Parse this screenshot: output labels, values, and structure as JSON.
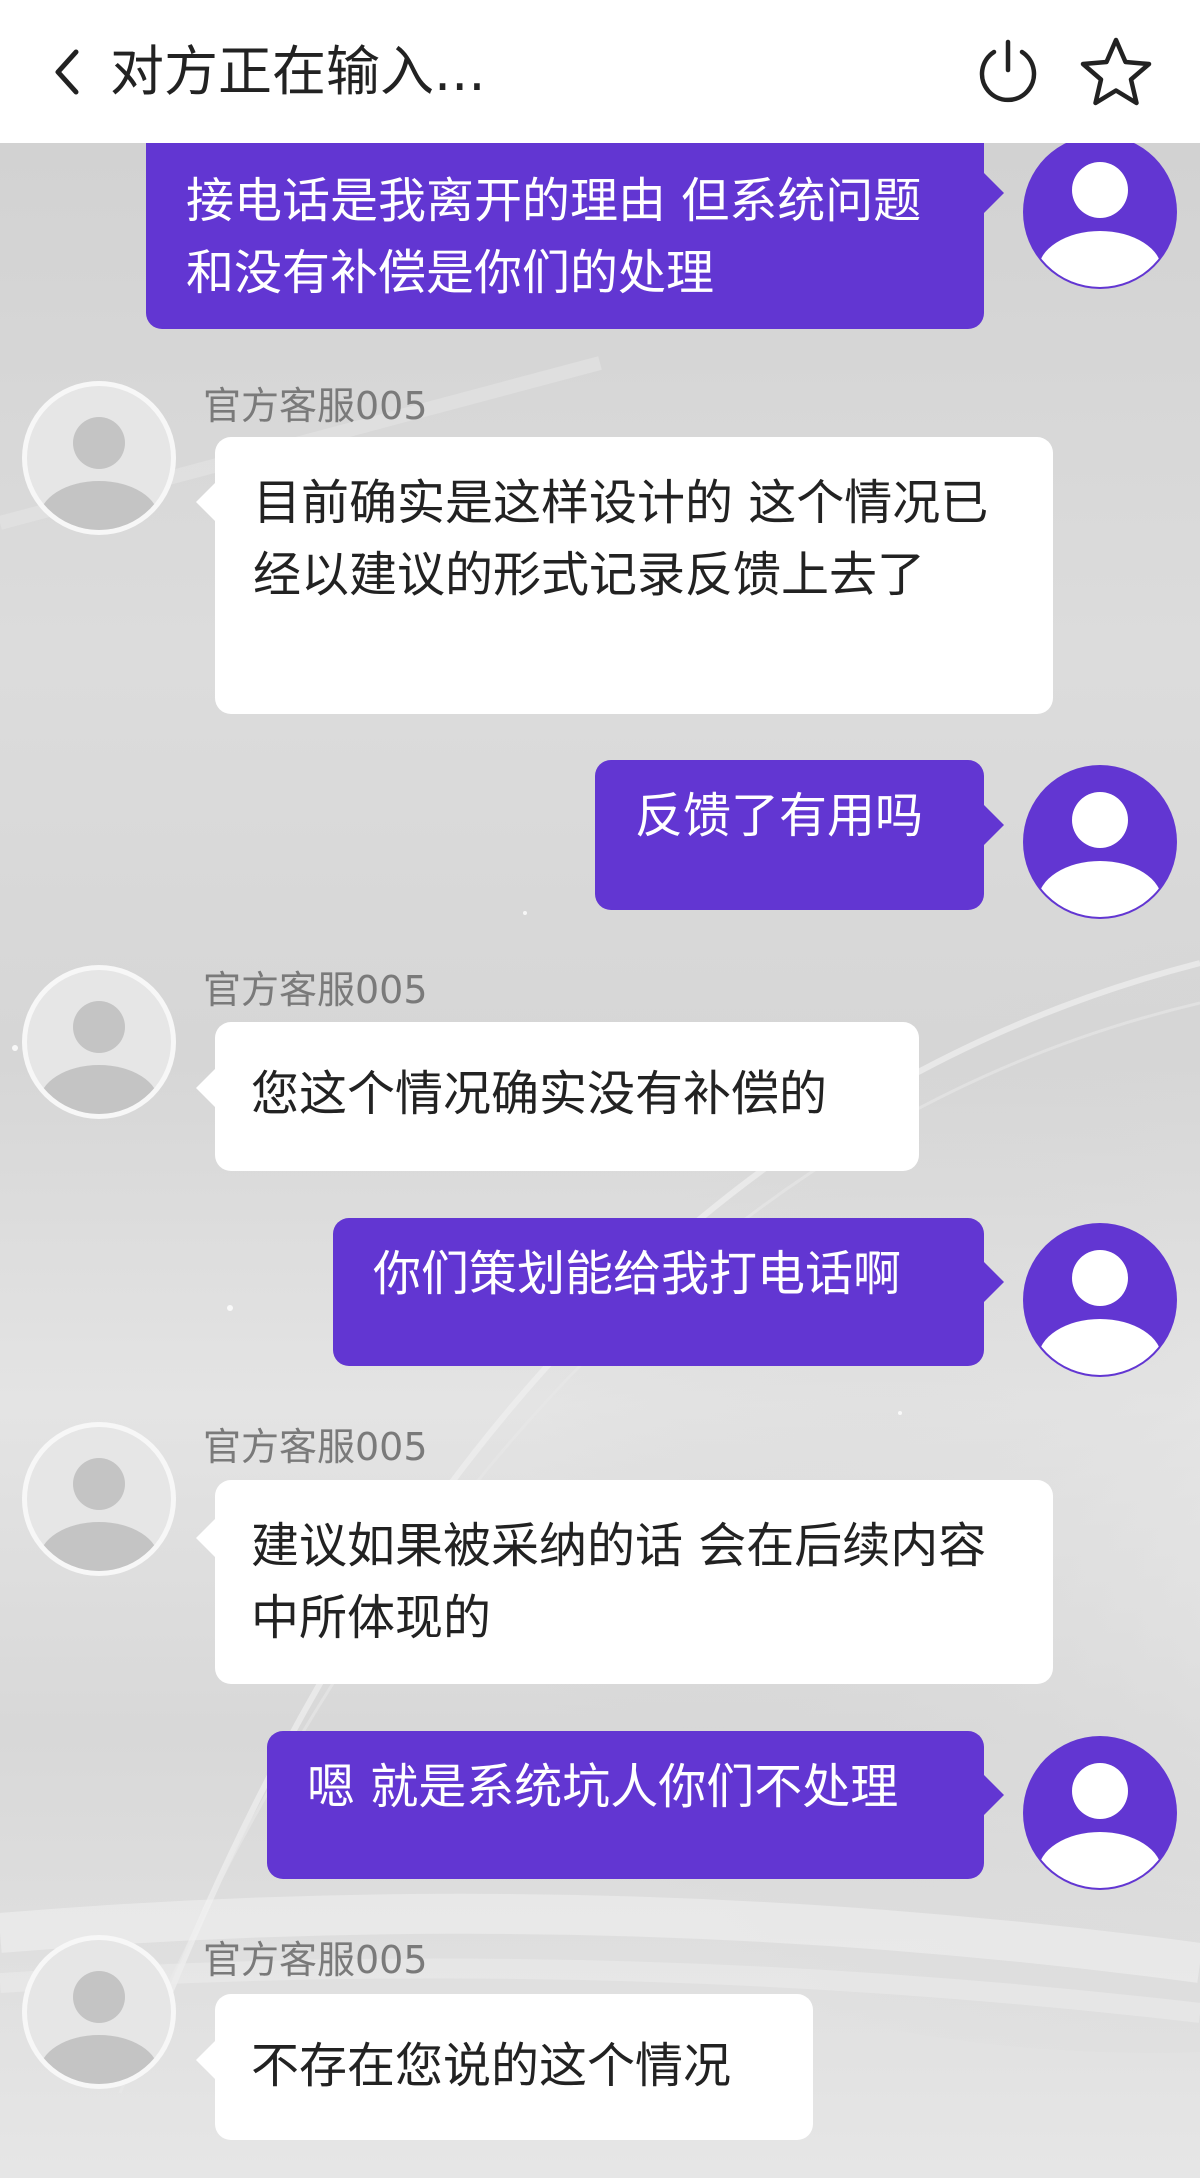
{
  "header": {
    "title": "对方正在输入..."
  },
  "messages": [
    {
      "sender": "me",
      "text": "接电话是我离开的理由 但系统问题和没有补偿是你们的处理"
    },
    {
      "sender": "agent",
      "name": "官方客服005",
      "text": "目前确实是这样设计的 这个情况已经以建议的形式记录反馈上去了"
    },
    {
      "sender": "me",
      "text": "反馈了有用吗"
    },
    {
      "sender": "agent",
      "name": "官方客服005",
      "text": "您这个情况确实没有补偿的"
    },
    {
      "sender": "me",
      "text": "你们策划能给我打电话啊"
    },
    {
      "sender": "agent",
      "name": "官方客服005",
      "text": "建议如果被采纳的话 会在后续内容中所体现的"
    },
    {
      "sender": "me",
      "text": "嗯 就是系统坑人你们不处理"
    },
    {
      "sender": "agent",
      "name": "官方客服005",
      "text": "不存在您说的这个情况"
    }
  ],
  "colors": {
    "outgoing_bubble": "#6236d2",
    "incoming_bubble": "#ffffff",
    "header_bg": "#ffffff"
  },
  "icons": {
    "back": "chevron-left-icon",
    "power": "power-icon",
    "favorite": "star-outline-icon"
  }
}
